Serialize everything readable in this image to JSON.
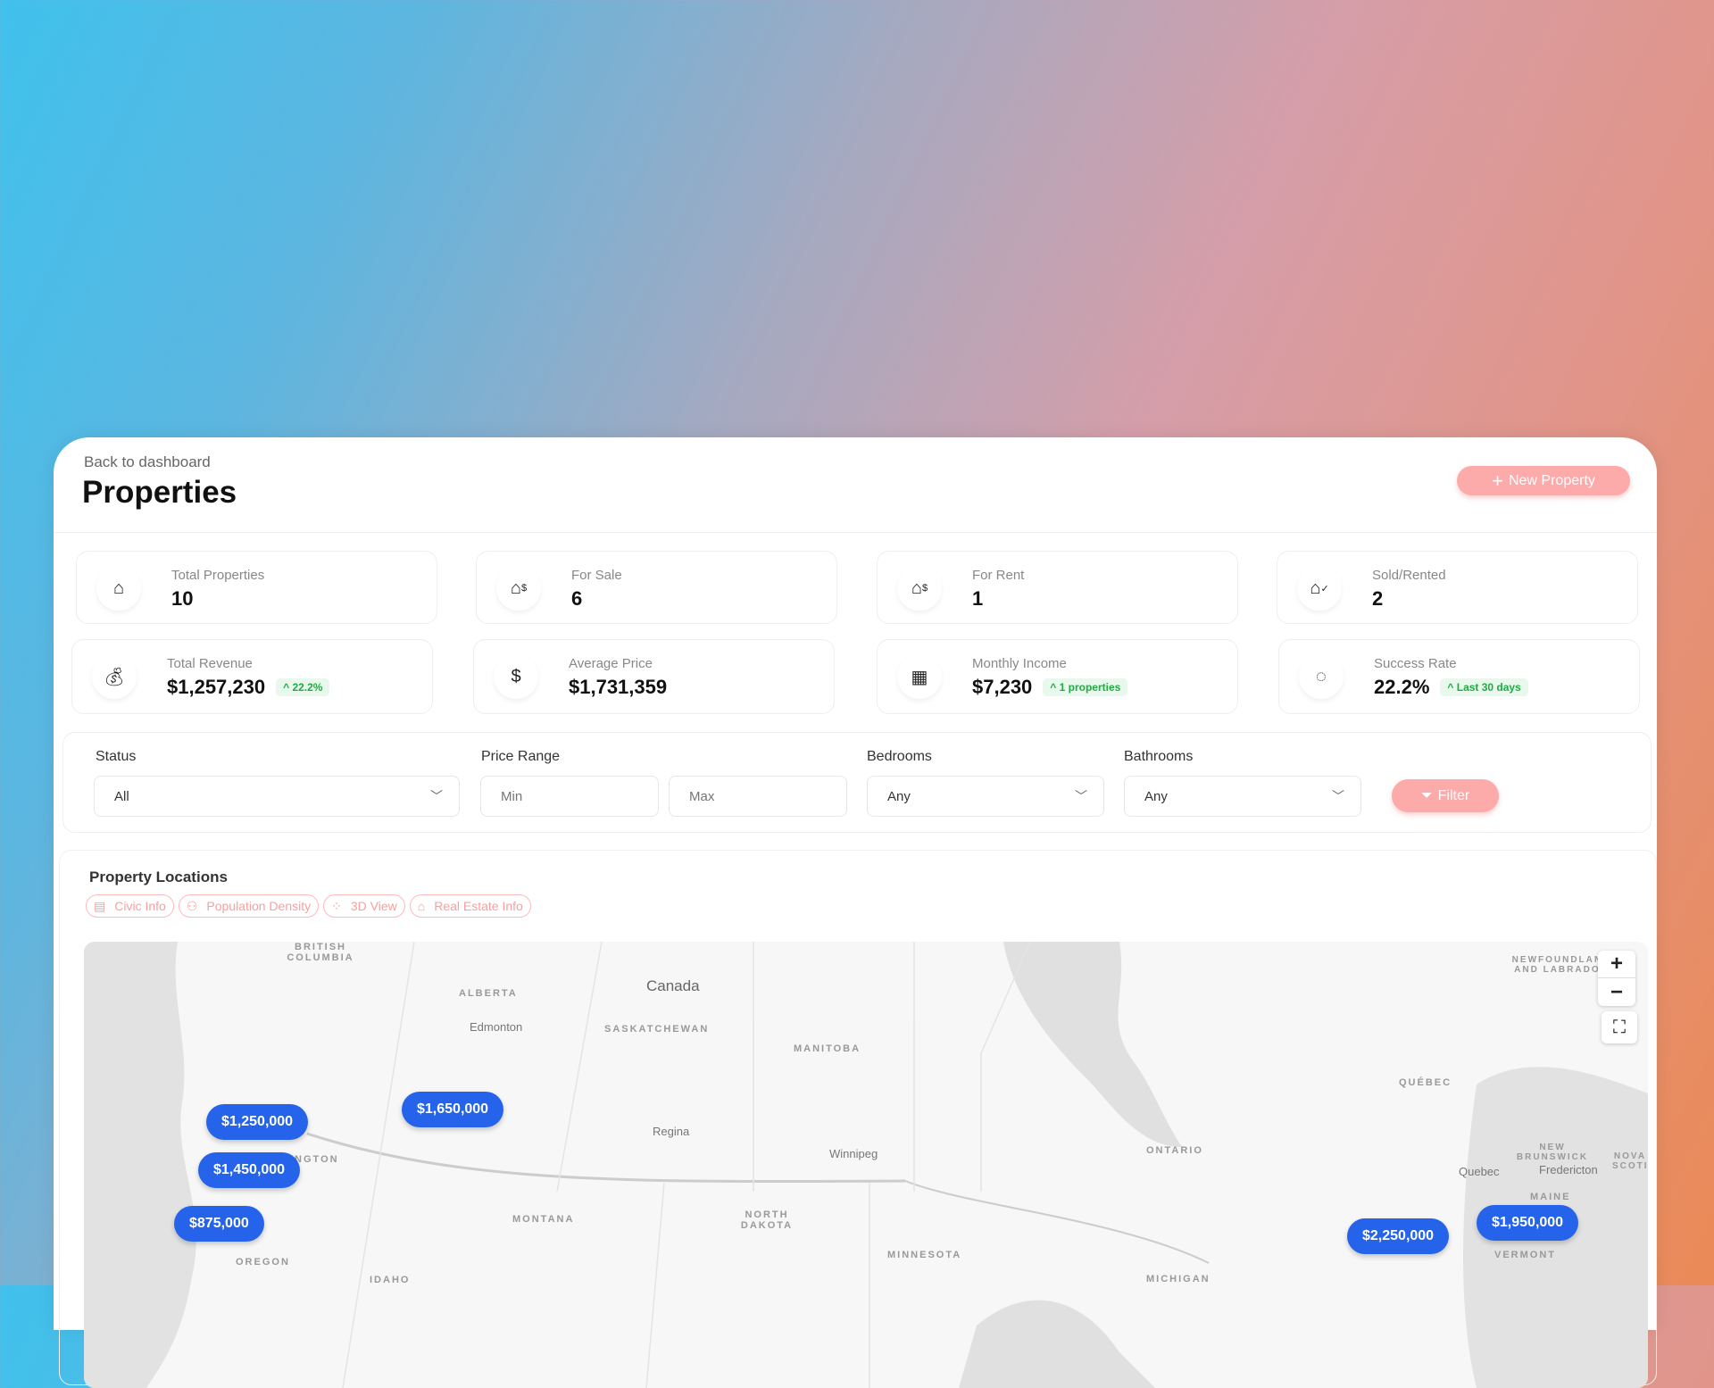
{
  "header": {
    "back_link": "Back to dashboard",
    "title": "Properties",
    "new_button": "New Property"
  },
  "stats": [
    {
      "label": "Total Properties",
      "value": "10",
      "icon": "home-icon"
    },
    {
      "label": "For Sale",
      "value": "6",
      "icon": "home-dollar-icon"
    },
    {
      "label": "For Rent",
      "value": "1",
      "icon": "home-dollar-icon"
    },
    {
      "label": "Sold/Rented",
      "value": "2",
      "icon": "home-check-icon"
    },
    {
      "label": "Total Revenue",
      "value": "$1,257,230",
      "badge": "^ 22.2%",
      "icon": "money-bag-icon"
    },
    {
      "label": "Average Price",
      "value": "$1,731,359",
      "icon": "dollar-icon"
    },
    {
      "label": "Monthly Income",
      "value": "$7,230",
      "badge": "^ 1 properties",
      "icon": "calendar-dollar-icon"
    },
    {
      "label": "Success Rate",
      "value": "22.2%",
      "badge": "^ Last 30 days",
      "icon": "dashed-check-circle-icon"
    }
  ],
  "filters": {
    "status_label": "Status",
    "status_value": "All",
    "price_label": "Price Range",
    "min_placeholder": "Min",
    "max_placeholder": "Max",
    "bedrooms_label": "Bedrooms",
    "bedrooms_value": "Any",
    "bathrooms_label": "Bathrooms",
    "bathrooms_value": "Any",
    "filter_button": "Filter"
  },
  "map": {
    "title": "Property Locations",
    "chips": [
      "Civic Info",
      "Population Density",
      "3D View",
      "Real Estate Info"
    ],
    "labels": {
      "bc": "BRITISH COLUMBIA",
      "alberta": "ALBERTA",
      "canada": "Canada",
      "edmonton": "Edmonton",
      "sask": "SASKATCHEWAN",
      "manitoba": "MANITOBA",
      "regina": "Regina",
      "winnipeg": "Winnipeg",
      "ontario": "ONTARIO",
      "quebec_prov": "QUÉBEC",
      "quebec": "Quebec",
      "nb": "NEW BRUNSWICK",
      "fredericton": "Fredericton",
      "nl": "NEWFOUNDLAND AND LABRADOR",
      "ns": "NOVA SCOTIA",
      "maine": "MAINE",
      "vermont": "VERMONT",
      "montana": "MONTANA",
      "nd": "NORTH DAKOTA",
      "minnesota": "MINNESOTA",
      "oregon": "OREGON",
      "idaho": "IDAHO",
      "michigan": "MICHIGAN",
      "washington": "WASHINGTON"
    },
    "markers": [
      "$1,250,000",
      "$1,650,000",
      "$1,450,000",
      "$875,000",
      "$2,250,000",
      "$1,950,000"
    ],
    "zoom_in": "+",
    "zoom_out": "−"
  },
  "colors": {
    "accent": "#fdaaaa",
    "marker": "#2563eb",
    "badge_green": "#22aa44"
  }
}
